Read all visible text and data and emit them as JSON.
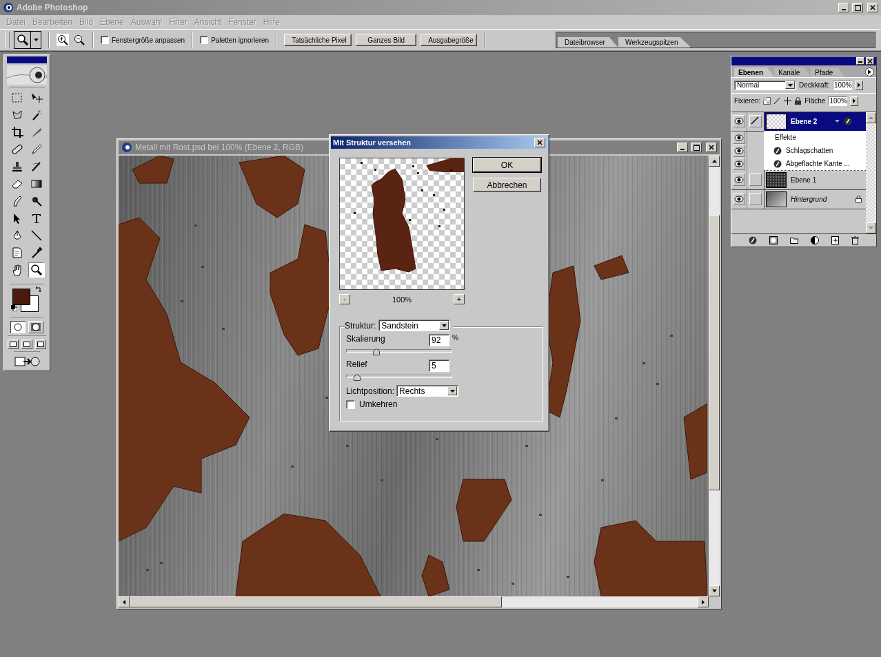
{
  "window": {
    "title": "Adobe Photoshop"
  },
  "menu": [
    {
      "label": "Datei",
      "disabled": true
    },
    {
      "label": "Bearbeiten",
      "disabled": true
    },
    {
      "label": "Bild",
      "disabled": true
    },
    {
      "label": "Ebene",
      "disabled": true
    },
    {
      "label": "Auswahl",
      "disabled": true
    },
    {
      "label": "Filter",
      "disabled": true
    },
    {
      "label": "Ansicht",
      "disabled": true
    },
    {
      "label": "Fenster",
      "disabled": true
    },
    {
      "label": "Hilfe",
      "disabled": true
    }
  ],
  "options_bar": {
    "checkboxes": [
      {
        "label": "Fenstergröße anpassen",
        "checked": false
      },
      {
        "label": "Paletten ignorieren",
        "checked": false
      }
    ],
    "buttons": [
      "Tatsächliche Pixel",
      "Ganzes Bild",
      "Ausgabegröße"
    ]
  },
  "palette_well": {
    "tabs": [
      "Dateibrowser",
      "Werkzeugspitzen"
    ]
  },
  "toolbox": {
    "tools": [
      {
        "kind": "marquee",
        "selected": false
      },
      {
        "kind": "move",
        "selected": false
      },
      {
        "kind": "lasso",
        "selected": false
      },
      {
        "kind": "wand",
        "selected": false
      },
      {
        "kind": "crop",
        "selected": false
      },
      {
        "kind": "slice",
        "selected": false
      },
      {
        "kind": "bandage",
        "selected": false
      },
      {
        "kind": "pencil",
        "selected": false
      },
      {
        "kind": "stamp",
        "selected": false
      },
      {
        "kind": "history",
        "selected": false
      },
      {
        "kind": "eraser",
        "selected": false
      },
      {
        "kind": "gradient",
        "selected": false
      },
      {
        "kind": "smudge",
        "selected": false
      },
      {
        "kind": "burn",
        "selected": false
      },
      {
        "kind": "arrow",
        "selected": false
      },
      {
        "kind": "type",
        "selected": false
      },
      {
        "kind": "pen",
        "selected": false
      },
      {
        "kind": "line",
        "selected": false
      },
      {
        "kind": "notes",
        "selected": false
      },
      {
        "kind": "eyedropper",
        "selected": false
      },
      {
        "kind": "hand",
        "selected": false
      },
      {
        "kind": "zoom",
        "selected": true
      }
    ]
  },
  "document": {
    "title": "Metall mit Rost.psd bei 100% (Ebene 2, RGB)"
  },
  "dialog": {
    "title": "Mit Struktur versehen",
    "buttons": [
      "OK",
      "Abbrechen"
    ],
    "zoom_out": "-",
    "zoom": "100%",
    "zoom_in": "+",
    "texture": {
      "label": "Struktur:",
      "value": "Sandstein"
    },
    "scaling": {
      "label": "Skalierung",
      "value": "92",
      "unit": "%",
      "level": 0.28
    },
    "relief": {
      "label": "Relief",
      "value": "5",
      "level": 0.1
    },
    "light": {
      "label": "Lichtposition:",
      "value": "Rechts"
    },
    "invert": {
      "label": "Umkehren",
      "checked": false
    }
  },
  "layers_panel": {
    "tabs": [
      {
        "label": "Ebenen",
        "selected": true
      },
      {
        "label": "Kanäle",
        "selected": false
      },
      {
        "label": "Pfade",
        "selected": false
      }
    ],
    "blend_mode": "Normal",
    "opacity_label": "Deckkraft:",
    "opacity": "100%",
    "lock_label": "Fixieren:",
    "fill_label": "Fläche",
    "fill": "100%",
    "layers": [
      {
        "name": "Ebene 2",
        "kind": "layer",
        "selected": true,
        "visible": true,
        "locked": false,
        "effects_label": "Effekte",
        "effects": [
          {
            "name": "Schlagschatten",
            "visible": true
          },
          {
            "name": "Abgeflachte Kante ...",
            "visible": true
          }
        ]
      },
      {
        "name": "Ebene 1",
        "kind": "layer",
        "selected": false,
        "visible": true,
        "locked": false
      },
      {
        "name": "Hintergrund",
        "kind": "background",
        "selected": false,
        "visible": true,
        "locked": true
      }
    ]
  }
}
